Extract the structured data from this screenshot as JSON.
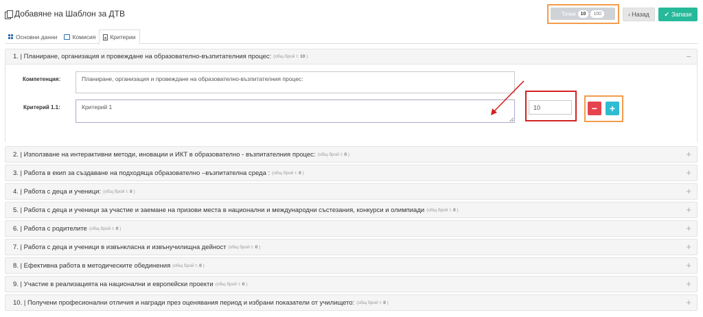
{
  "header": {
    "title": "Добавяне на Шаблон за ДТВ",
    "points_label": "Точки",
    "points_current": "10",
    "points_max": "100",
    "back_label": "Назад",
    "save_label": "Запази",
    "icons": {
      "title": "copy-icon",
      "back": "chevron-left-icon",
      "save": "check-icon"
    }
  },
  "tabs": [
    {
      "label": "Основни данни",
      "icon": "grid-icon",
      "active": false
    },
    {
      "label": "Комисия",
      "icon": "cube-icon",
      "active": false
    },
    {
      "label": "Критерии",
      "icon": "document-icon",
      "active": true
    }
  ],
  "open_section": {
    "title": "1. | Планиране, организация и провеждане на образователно-възпитателния процес:",
    "count_label": "(общ брой т.",
    "count_value": "10",
    "count_close": ")",
    "toggle": "−",
    "competence_label": "Компетенция:",
    "competence_value": "Планиране, организация и провеждане на образователно-възпитателния процес:",
    "criterion_label": "Критерий 1.1:",
    "criterion_value": "Критерий 1",
    "criterion_points": "10",
    "minus_label": "−",
    "plus_label": "+"
  },
  "sections": [
    {
      "title": "2. | Използване на интерактивни методи, иновации и ИКТ в образователно - възпитателния процес:",
      "count_label": "(общ брой т.",
      "count_value": "0",
      "count_close": ")",
      "toggle": "+"
    },
    {
      "title": "3. | Работа в екип за създаване на подходяща образователно –възпитателна среда :",
      "count_label": "(общ брой т.",
      "count_value": "0",
      "count_close": ")",
      "toggle": "+"
    },
    {
      "title": "4. | Работа с деца и ученици:",
      "count_label": "(общ брой т.",
      "count_value": "0",
      "count_close": ")",
      "toggle": "+"
    },
    {
      "title": "5. | Работа с деца и ученици за участие и заемане на призови места в национални и международни състезания, конкурси и олимпиади",
      "count_label": "(общ брой т.",
      "count_value": "0",
      "count_close": ")",
      "toggle": "+"
    },
    {
      "title": "6. | Работа с родителите",
      "count_label": "(общ брой т.",
      "count_value": "0",
      "count_close": ")",
      "toggle": "+"
    },
    {
      "title": "7. | Работа с деца и ученици в извънкласна и извънучилищна дейност",
      "count_label": "(общ брой т.",
      "count_value": "0",
      "count_close": ")",
      "toggle": "+"
    },
    {
      "title": "8. | Ефективна работа в методическите обединения",
      "count_label": "(общ брой т.",
      "count_value": "0",
      "count_close": ")",
      "toggle": "+"
    },
    {
      "title": "9. | Участие в реализацията на национални и европейски проекти",
      "count_label": "(общ брой т.",
      "count_value": "0",
      "count_close": ")",
      "toggle": "+"
    },
    {
      "title": "10. | Получени професионални отличия и награди през оценявания период и избрани показатели от училището:",
      "count_label": "(общ брой т.",
      "count_value": "0",
      "count_close": ")",
      "toggle": "+"
    }
  ],
  "colors": {
    "accent_green": "#26b99a",
    "annotation_red": "#d42020",
    "annotation_orange": "#f39c4a",
    "minus_red": "#e5444d",
    "plus_cyan": "#2ebcd3"
  }
}
